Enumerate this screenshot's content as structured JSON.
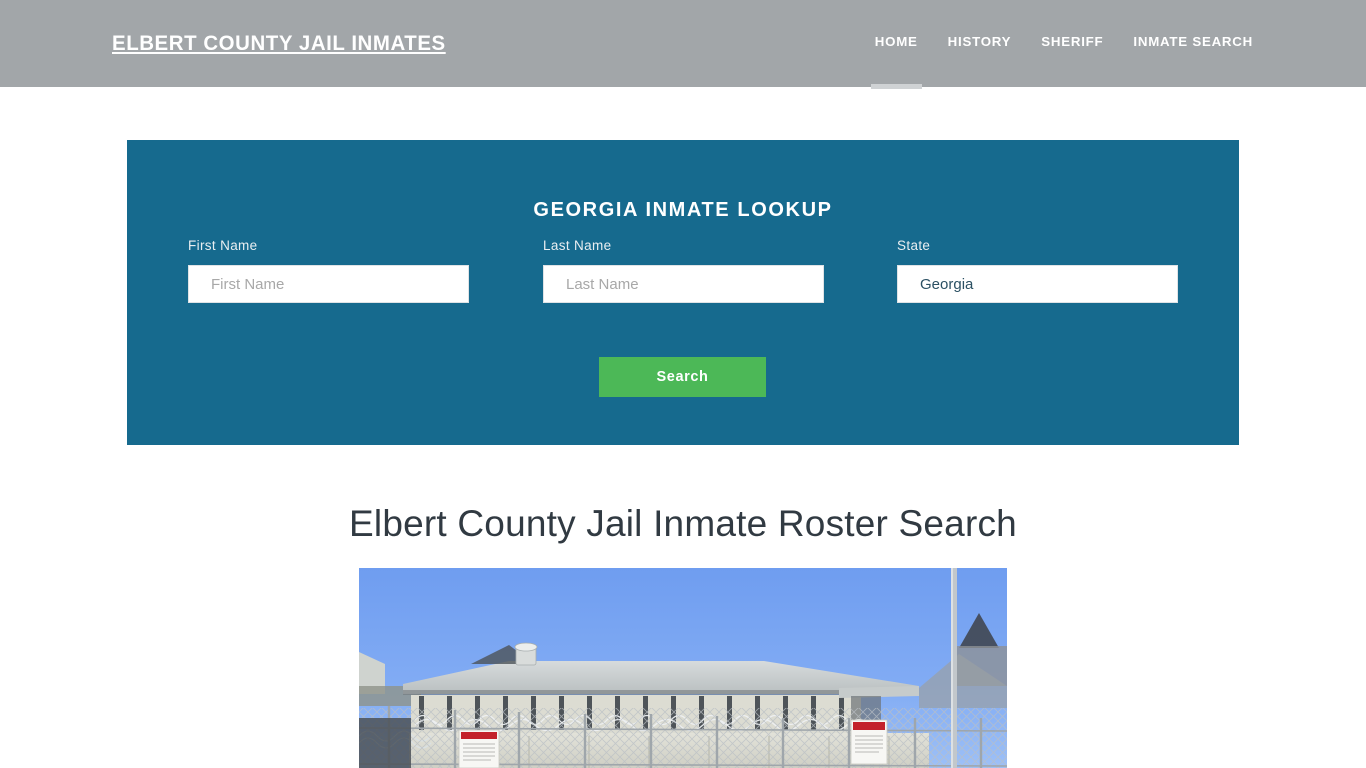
{
  "header": {
    "brand": "Elbert County Jail Inmates",
    "nav": [
      {
        "label": "Home",
        "active": true
      },
      {
        "label": "History",
        "active": false
      },
      {
        "label": "Sheriff",
        "active": false
      },
      {
        "label": "Inmate Search",
        "active": false
      }
    ]
  },
  "lookup": {
    "title": "Georgia Inmate Lookup",
    "fields": [
      {
        "label": "First Name",
        "placeholder": "First Name",
        "value": ""
      },
      {
        "label": "Last Name",
        "placeholder": "Last Name",
        "value": ""
      },
      {
        "label": "State",
        "placeholder": "",
        "value": "Georgia"
      }
    ],
    "submit_label": "Search"
  },
  "main": {
    "heading": "Elbert County Jail Inmate Roster Search",
    "photo_alt": "Elbert County Jail exterior with razor wire fence"
  },
  "colors": {
    "header_bg": "#a2a6a9",
    "panel_bg": "#166a8e",
    "accent_green": "#4cb857",
    "heading_text": "#313a42",
    "nav_active_bar": "#cfd2d4",
    "sky": "#79a5f2"
  }
}
